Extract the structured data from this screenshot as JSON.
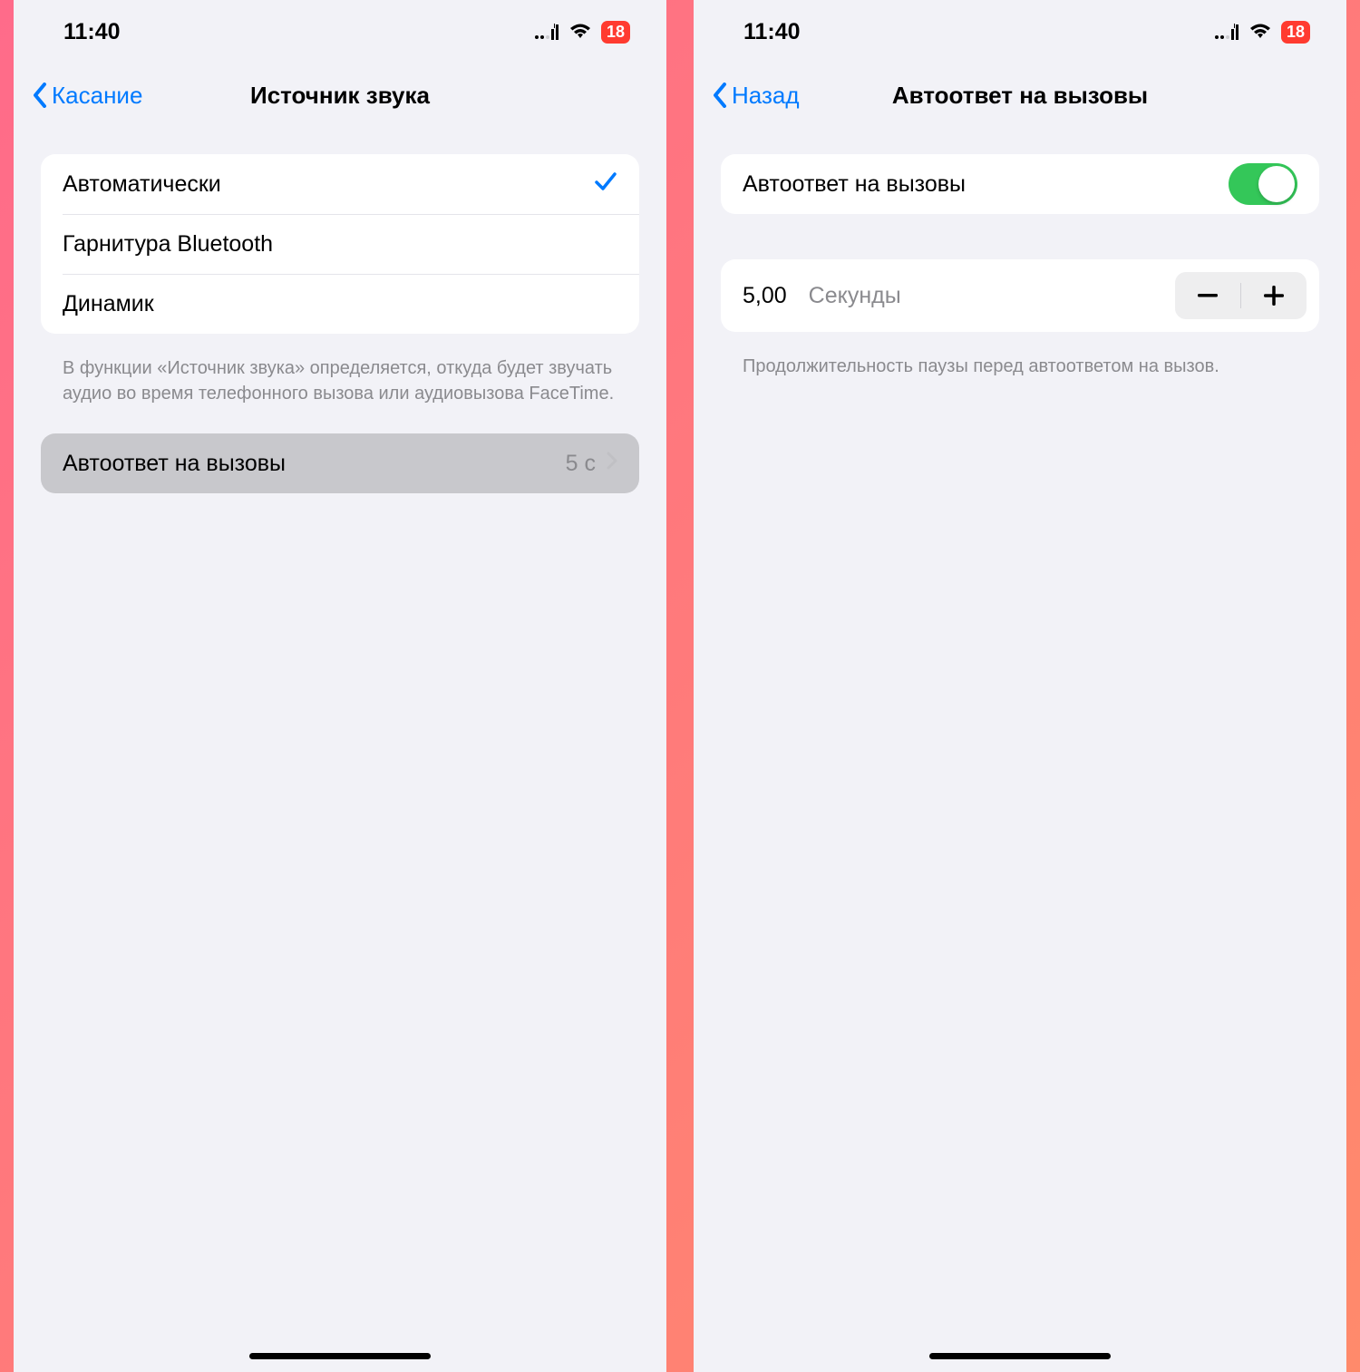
{
  "status": {
    "time": "11:40",
    "battery": "18"
  },
  "left": {
    "back": "Касание",
    "title": "Источник звука",
    "options": {
      "auto": "Автоматически",
      "bluetooth": "Гарнитура Bluetooth",
      "speaker": "Динамик"
    },
    "footer": "В функции «Источник звука» определяется, откуда будет звучать аудио во время телефонного вызова или аудиовызова FaceTime.",
    "autoAnswer": {
      "label": "Автоответ на вызовы",
      "value": "5 с"
    }
  },
  "right": {
    "back": "Назад",
    "title": "Автоответ на вызовы",
    "toggleLabel": "Автоответ на вызовы",
    "stepper": {
      "value": "5,00",
      "unit": "Секунды"
    },
    "footer": "Продолжительность паузы перед автоответом на вызов."
  }
}
